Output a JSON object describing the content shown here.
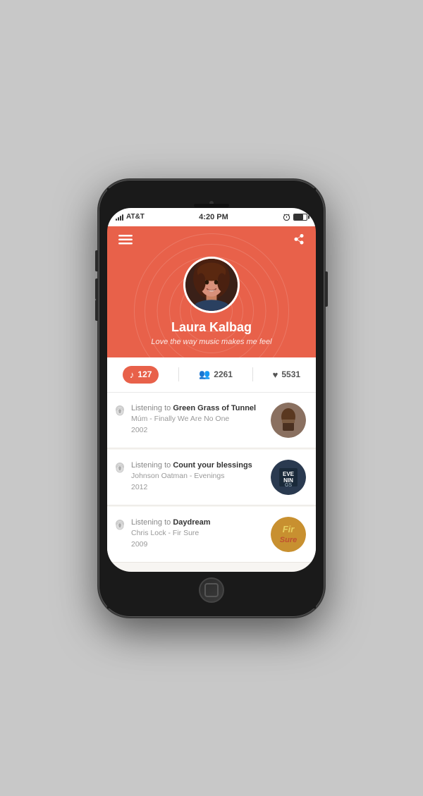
{
  "status_bar": {
    "carrier": "AT&T",
    "time": "4:20 PM",
    "battery_icon": "battery"
  },
  "toolbar": {
    "menu_label": "☰",
    "share_label": "➤"
  },
  "profile": {
    "name": "Laura Kalbag",
    "bio": "Love the way music makes me feel"
  },
  "stats": {
    "songs": "127",
    "followers": "2261",
    "likes": "5531"
  },
  "activity": [
    {
      "prefix": "Listening to ",
      "song": "Green Grass of Tunnel",
      "artist": "Múm",
      "album": "Finally We Are No One",
      "year": "2002",
      "thumb_color": "#8B7355"
    },
    {
      "prefix": "Listening to ",
      "song": "Count your blessings",
      "artist": "Johnson Oatman",
      "album": "Evenings",
      "year": "2012",
      "thumb_color": "#2a3a4a"
    },
    {
      "prefix": "Listening to ",
      "song": "Daydream",
      "artist": "Chris Lock",
      "album": "Fir Sure",
      "year": "2009",
      "thumb_color": "#c8a040"
    }
  ],
  "colors": {
    "header_bg": "#e8614a",
    "active_stat_bg": "#e8614a"
  }
}
